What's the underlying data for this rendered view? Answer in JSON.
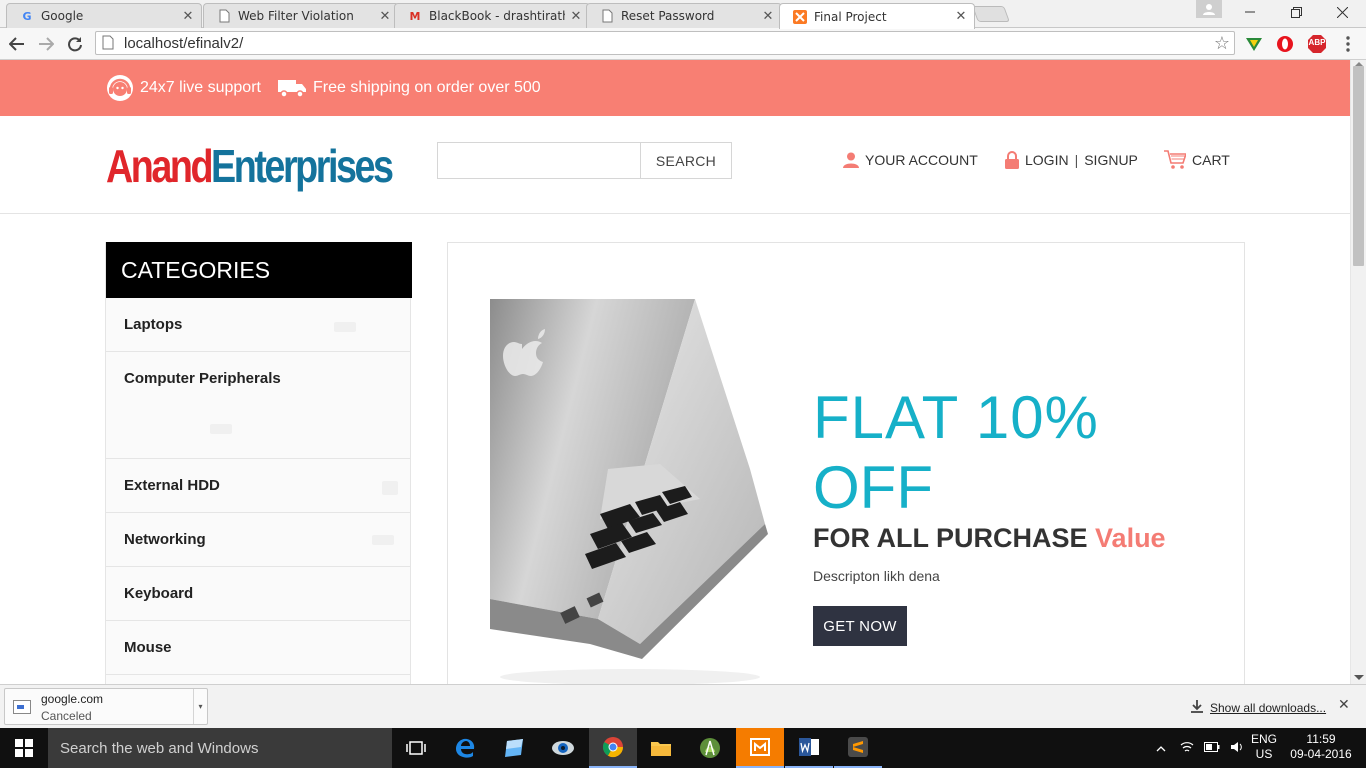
{
  "browser": {
    "tabs": [
      {
        "title": "Google",
        "favicon": "google-icon",
        "active": false
      },
      {
        "title": "Web Filter Violation",
        "favicon": "page-icon",
        "active": false
      },
      {
        "title": "BlackBook - drashtirathod",
        "favicon": "gmail-icon",
        "active": false
      },
      {
        "title": "Reset Password",
        "favicon": "page-icon",
        "active": false
      },
      {
        "title": "Final Project",
        "favicon": "xampp-icon",
        "active": true
      }
    ],
    "url": "localhost/efinalv2/",
    "extensions": [
      "shield-extension-icon",
      "opera-extension-icon",
      "adblock-extension-icon"
    ],
    "adblock_label": "ABP"
  },
  "topbar": {
    "support": "24x7 live support",
    "shipping": "Free shipping on order over 500"
  },
  "header": {
    "logo_part1": "Anand",
    "logo_part2": "Enterprises",
    "search_value": "",
    "search_button": "SEARCH",
    "account": "YOUR ACCOUNT",
    "login": "LOGIN",
    "login_sep": "|",
    "signup": "SIGNUP",
    "cart": "CART"
  },
  "categories": {
    "heading": "CATEGORIES",
    "items": [
      {
        "label": "Laptops"
      },
      {
        "label": "Computer Peripherals"
      },
      {
        "label": "External HDD"
      },
      {
        "label": "Networking"
      },
      {
        "label": "Keyboard"
      },
      {
        "label": "Mouse"
      }
    ]
  },
  "banner": {
    "line1": "FLAT 10%",
    "line2": "OFF",
    "line3_main": "FOR ALL PURCHASE",
    "line3_accent": "Value",
    "description": "Descripton likh dena",
    "button": "GET NOW"
  },
  "downloads": {
    "item_name": "google.com",
    "item_status": "Canceled",
    "show_all": "Show all downloads..."
  },
  "taskbar": {
    "search_placeholder": "Search the web and Windows",
    "lang_1": "ENG",
    "lang_2": "US",
    "time": "11:59",
    "date": "09-04-2016"
  },
  "colors": {
    "topbar": "#f87f73",
    "logo_red": "#e0262b",
    "logo_blue": "#14739c",
    "offer_cyan": "#16b0c8",
    "accent_salmon": "#f47c74",
    "button_dark": "#2f3341"
  }
}
